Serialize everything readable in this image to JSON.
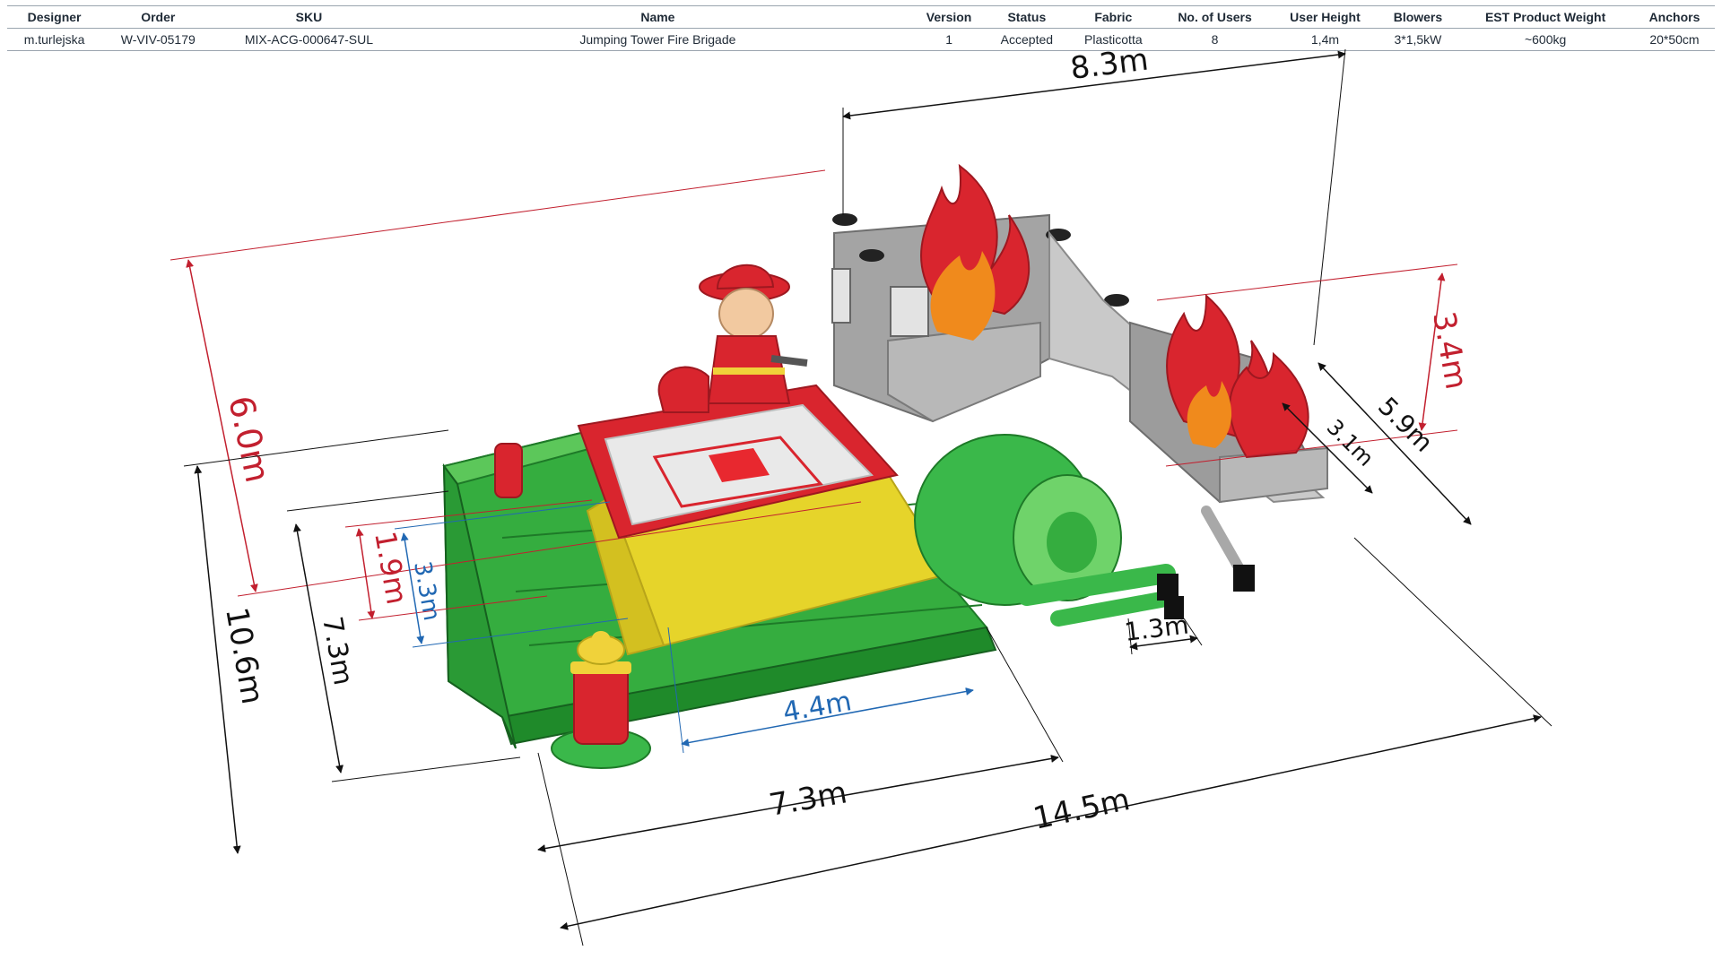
{
  "table": {
    "headers": [
      "Designer",
      "Order",
      "SKU",
      "Name",
      "Version",
      "Status",
      "Fabric",
      "No. of Users",
      "User  Height",
      "Blowers",
      "EST Product Weight",
      "Anchors"
    ],
    "row": [
      "m.turlejska",
      "W-VIV-05179",
      "MIX-ACG-000647-SUL",
      "Jumping Tower Fire Brigade",
      "1",
      "Accepted",
      "Plasticotta",
      "8",
      "1,4m",
      "3*1,5kW",
      "~600kg",
      "20*50cm"
    ]
  },
  "dimensions": {
    "top_width": "8.3m",
    "tower_height": "3.4m",
    "side_depth": "5.9m",
    "inner_depth": "3.1m",
    "total_width": "6.0m",
    "left_depth": "10.6m",
    "front_depth": "7.3m",
    "jump_red": "1.9m",
    "jump_blue": "3.3m",
    "jump_length": "4.4m",
    "front_length": "7.3m",
    "total_length": "14.5m",
    "blower_gap": "1.3m"
  },
  "colors": {
    "green": "#2fa83a",
    "green_dark": "#1e7a28",
    "yellow": "#e6d42a",
    "red": "#d9252e",
    "grey": "#9a9a9a",
    "orange": "#f08a1c",
    "dim_red": "#c2202f",
    "dim_blue": "#2168b3"
  }
}
